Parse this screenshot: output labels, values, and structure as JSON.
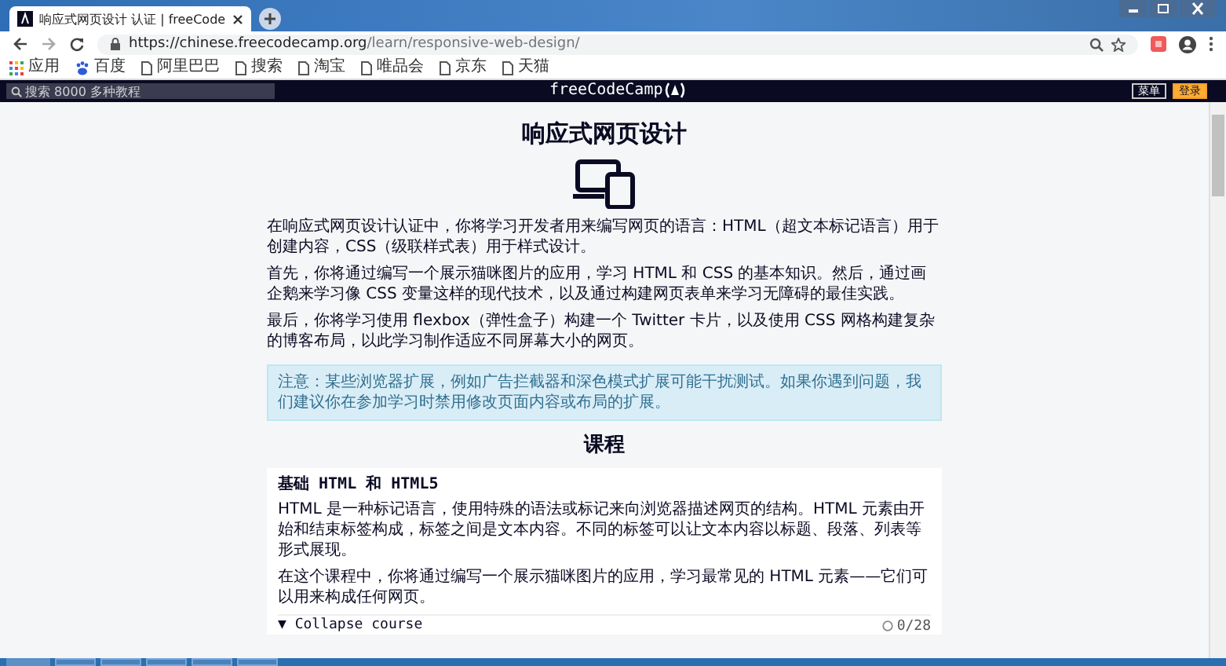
{
  "browser": {
    "tab_title": "响应式网页设计 认证 | freeCode",
    "url_host": "https://chinese.freecodecamp.org",
    "url_path": "/learn/responsive-web-design/",
    "bookmarks": [
      {
        "label": "应用",
        "kind": "apps"
      },
      {
        "label": "百度",
        "kind": "baidu"
      },
      {
        "label": "阿里巴巴",
        "kind": "page"
      },
      {
        "label": "搜索",
        "kind": "page"
      },
      {
        "label": "淘宝",
        "kind": "page"
      },
      {
        "label": "唯品会",
        "kind": "page"
      },
      {
        "label": "京东",
        "kind": "page"
      },
      {
        "label": "天猫",
        "kind": "page"
      }
    ]
  },
  "navbar": {
    "search_placeholder": "搜索 8000 多种教程",
    "brand": "freeCodeCamp",
    "menu_button": "菜单",
    "signin_button": "登录"
  },
  "page": {
    "title": "响应式网页设计",
    "paragraphs": [
      "在响应式网页设计认证中，你将学习开发者用来编写网页的语言：HTML（超文本标记语言）用于创建内容，CSS（级联样式表）用于样式设计。",
      "首先，你将通过编写一个展示猫咪图片的应用，学习 HTML 和 CSS 的基本知识。然后，通过画企鹅来学习像 CSS 变量这样的现代技术，以及通过构建网页表单来学习无障碍的最佳实践。",
      "最后，你将学习使用 flexbox（弹性盒子）构建一个 Twitter 卡片，以及使用 CSS 网格构建复杂的博客布局，以此学习制作适应不同屏幕大小的网页。"
    ],
    "note": "注意：某些浏览器扩展，例如广告拦截器和深色模式扩展可能干扰测试。如果你遇到问题，我们建议你在参加学习时禁用修改页面内容或布局的扩展。",
    "courses_heading": "课程",
    "course": {
      "title": "基础 HTML 和 HTML5",
      "paragraphs": [
        "HTML 是一种标记语言，使用特殊的语法或标记来向浏览器描述网页的结构。HTML 元素由开始和结束标签构成，标签之间是文本内容。不同的标签可以让文本内容以标题、段落、列表等形式展现。",
        "在这个课程中，你将通过编写一个展示猫咪图片的应用，学习最常见的 HTML 元素——它们可以用来构成任何网页。"
      ],
      "toggle": "▼ Collapse course",
      "expanded": true,
      "progress": "0/28"
    }
  }
}
